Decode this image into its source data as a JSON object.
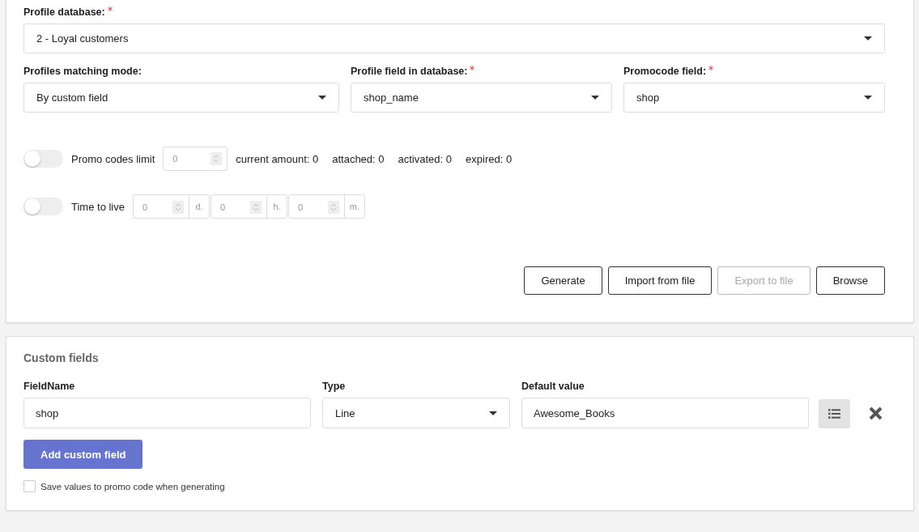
{
  "profile_database": {
    "label": "Profile database:",
    "required": true,
    "value": "2 - Loyal customers"
  },
  "matching": [
    {
      "label": "Profiles matching mode:",
      "required": false,
      "value": "By custom field"
    },
    {
      "label": "Profile field in database:",
      "required": true,
      "value": "shop_name"
    },
    {
      "label": "Promocode field:",
      "required": true,
      "value": "shop"
    }
  ],
  "promo_codes_limit": {
    "label": "Promo codes limit",
    "on": false,
    "placeholder": "0",
    "stats": [
      "current amount: 0",
      "attached: 0",
      "activated: 0",
      "expired: 0"
    ]
  },
  "time_to_live": {
    "label": "Time to live",
    "on": false,
    "units": [
      {
        "placeholder": "0",
        "unit": "d."
      },
      {
        "placeholder": "0",
        "unit": "h."
      },
      {
        "placeholder": "0",
        "unit": "m."
      }
    ]
  },
  "buttons": [
    {
      "label": "Generate",
      "disabled": false
    },
    {
      "label": "Import from file",
      "disabled": false
    },
    {
      "label": "Export to file",
      "disabled": true
    },
    {
      "label": "Browse",
      "disabled": false
    }
  ],
  "custom_fields": {
    "title": "Custom fields",
    "columns": [
      "FieldName",
      "Type",
      "Default value"
    ],
    "rows": [
      {
        "field_name": "shop",
        "type": "Line",
        "default_value": "Awesome_Books"
      }
    ],
    "add_button": "Add custom field",
    "save_values": {
      "label": "Save values to promo code when generating",
      "checked": false
    }
  }
}
